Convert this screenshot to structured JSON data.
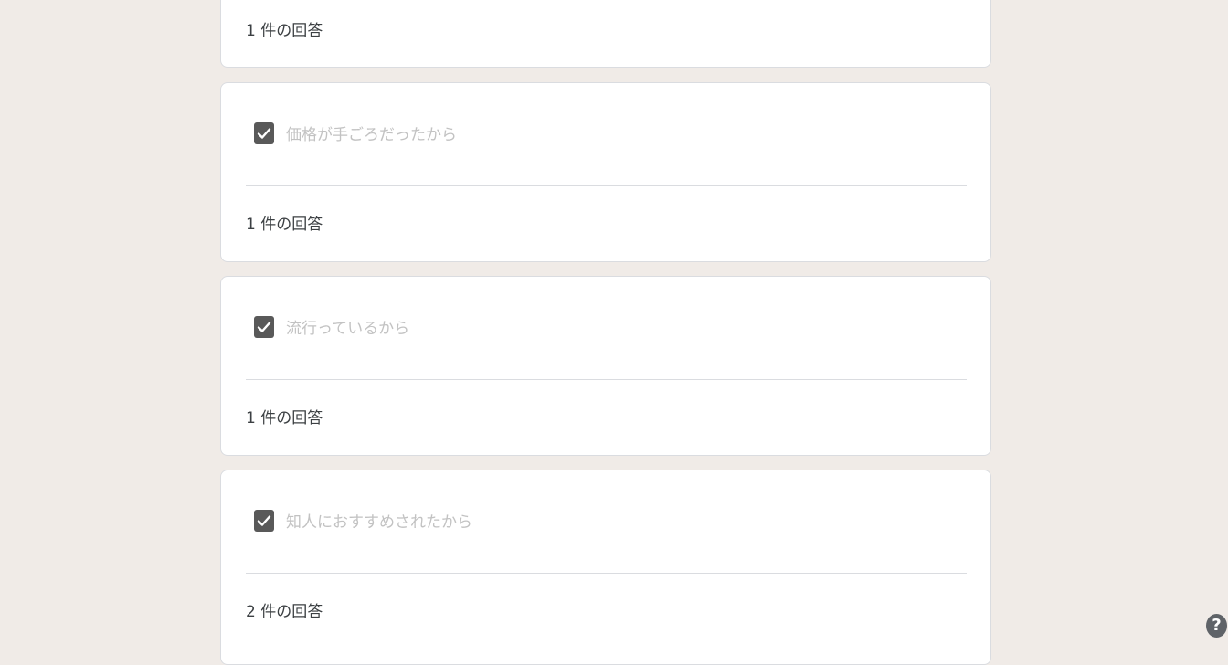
{
  "top_card": {
    "response_count": "1 件の回答"
  },
  "cards": [
    {
      "option_label": "価格が手ごろだったから",
      "checked": true,
      "response_count": "1 件の回答"
    },
    {
      "option_label": "流行っているから",
      "checked": true,
      "response_count": "1 件の回答"
    },
    {
      "option_label": "知人におすすめされたから",
      "checked": true,
      "response_count": "2 件の回答"
    }
  ],
  "help": {
    "icon": "help-icon",
    "glyph": "?"
  },
  "colors": {
    "background": "#f0ebe7",
    "card": "#ffffff",
    "checkbox": "#595959",
    "label_disabled": "#c2c2c2",
    "text": "#3c4043"
  }
}
